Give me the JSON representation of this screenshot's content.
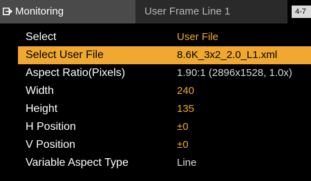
{
  "header": {
    "menu_tab_label": "Monitoring",
    "menu_tab_icon": "menu-exit-icon",
    "page_title": "User Frame Line 1",
    "page_indicator": "4-7"
  },
  "colors": {
    "accent": "#f0a830",
    "background": "#000000",
    "tab_active": "#4a4a4a",
    "tab_inactive": "#2a2a2a"
  },
  "menu": {
    "items": [
      {
        "label": "Select",
        "value": "User File",
        "value_style": "accent",
        "selected": false
      },
      {
        "label": "Select User File",
        "value": "8.6K_3x2_2.0_L1.xml",
        "value_style": "normal",
        "selected": true
      },
      {
        "label": "Aspect Ratio(Pixels)",
        "value": "1.90:1 (2896x1528, 1.0x)",
        "value_style": "normal",
        "selected": false
      },
      {
        "label": "Width",
        "value": "240",
        "value_style": "accent",
        "selected": false
      },
      {
        "label": "Height",
        "value": "135",
        "value_style": "accent",
        "selected": false
      },
      {
        "label": "H Position",
        "value": "±0",
        "value_style": "accent",
        "selected": false
      },
      {
        "label": "V Position",
        "value": "±0",
        "value_style": "accent",
        "selected": false
      },
      {
        "label": "Variable Aspect Type",
        "value": "Line",
        "value_style": "normal",
        "selected": false
      }
    ]
  }
}
